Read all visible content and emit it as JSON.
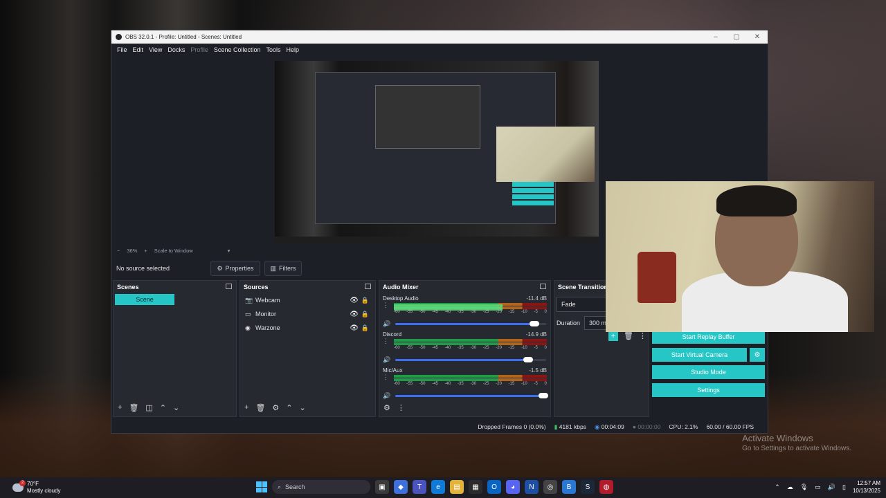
{
  "window": {
    "title": "OBS 32.0.1 - Profile: Untitled - Scenes: Untitled",
    "minimize": "–",
    "maximize": "▢",
    "close": "✕"
  },
  "menu": {
    "file": "File",
    "edit": "Edit",
    "view": "View",
    "docks": "Docks",
    "profile": "Profile",
    "scene_collection": "Scene Collection",
    "tools": "Tools",
    "help": "Help"
  },
  "preview": {
    "zoom_minus": "−",
    "zoom": "36%",
    "zoom_plus": "+",
    "scale_mode": "Scale to Window",
    "scale_arrow": "▾"
  },
  "source_toolbar": {
    "no_source": "No source selected",
    "properties": "Properties",
    "filters": "Filters"
  },
  "scenes": {
    "title": "Scenes",
    "items": [
      "Scene"
    ]
  },
  "sources": {
    "title": "Sources",
    "items": [
      {
        "icon": "camera-icon",
        "glyph": "📷",
        "label": "Webcam"
      },
      {
        "icon": "monitor-icon",
        "glyph": "▭",
        "label": "Monitor"
      },
      {
        "icon": "gamepad-icon",
        "glyph": "◉",
        "label": "Warzone"
      }
    ]
  },
  "mixer": {
    "title": "Audio Mixer",
    "ticks": [
      "-60",
      "-55",
      "-50",
      "-45",
      "-40",
      "-35",
      "-30",
      "-25",
      "-20",
      "-15",
      "-10",
      "-5",
      "0"
    ],
    "channels": [
      {
        "name": "Desktop Audio",
        "db": "-11.4 dB",
        "level": 0.71,
        "volume": 0.92
      },
      {
        "name": "Discord",
        "db": "-14.9 dB",
        "level": 0.0,
        "volume": 0.88
      },
      {
        "name": "Mic/Aux",
        "db": "-1.5 dB",
        "level": 0.0,
        "volume": 0.98
      }
    ]
  },
  "transitions": {
    "title": "Scene Transitions",
    "selected": "Fade",
    "duration_label": "Duration",
    "duration": "300 ms"
  },
  "controls": {
    "replay": "Start Replay Buffer",
    "virtual_cam": "Start Virtual Camera",
    "studio": "Studio Mode",
    "settings": "Settings"
  },
  "status": {
    "dropped": "Dropped Frames 0 (0.0%)",
    "bitrate": "4181 kbps",
    "stream_time": "00:04:09",
    "rec_time": "00:00:00",
    "cpu": "CPU: 2.1%",
    "fps": "60.00 / 60.00 FPS"
  },
  "activation": {
    "line1": "Activate Windows",
    "line2": "Go to Settings to activate Windows."
  },
  "taskbar": {
    "temp": "70°F",
    "condition": "Mostly cloudy",
    "badge": "2",
    "search_placeholder": "Search",
    "time": "12:57 AM",
    "date": "10/13/2025"
  },
  "colors": {
    "accent": "#27c6c6",
    "panel": "#262930",
    "window": "#1d1f26"
  }
}
